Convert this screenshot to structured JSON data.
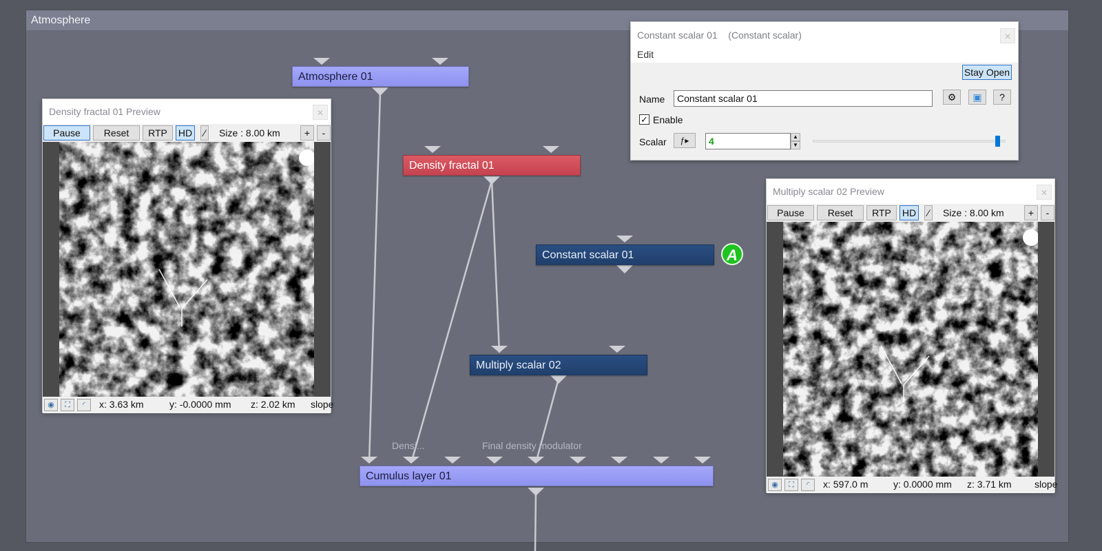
{
  "network": {
    "title": "Atmosphere"
  },
  "nodes": {
    "atmosphere": "Atmosphere 01",
    "density_fractal": "Density fractal 01",
    "constant_scalar": "Constant scalar 01",
    "multiply_scalar": "Multiply scalar 02",
    "cumulus_layer": "Cumulus layer 01"
  },
  "ports": {
    "densi": "Densi...",
    "final_density_modulator": "Final density modulator"
  },
  "badge": {
    "letter": "A",
    "color": "#1fc31f"
  },
  "preview_left": {
    "title": "Density fractal 01 Preview",
    "pause": "Pause",
    "reset": "Reset",
    "rtp": "RTP",
    "hd": "HD",
    "size": "Size :  8.00 km",
    "plus": "+",
    "minus": "-",
    "x": "x: 3.63 km",
    "y": "y: -0.0000 mm",
    "z": "z: 2.02 km",
    "slope": "slope"
  },
  "preview_right": {
    "title": "Multiply scalar 02 Preview",
    "pause": "Pause",
    "reset": "Reset",
    "rtp": "RTP",
    "hd": "HD",
    "size": "Size :  8.00 km",
    "plus": "+",
    "minus": "-",
    "x": "x: 597.0 m",
    "y": "y: 0.0000 mm",
    "z": "z: 3.71 km",
    "slope": "slope"
  },
  "edit_panel": {
    "title": "Constant scalar 01    (Constant scalar)",
    "menu_edit": "Edit",
    "stay_open": "Stay Open",
    "name_label": "Name",
    "name_value": "Constant scalar 01",
    "enable_label": "Enable",
    "enable_checked": "✓",
    "scalar_label": "Scalar",
    "scalar_value": "4",
    "help": "?",
    "slider_fraction": 0.97
  },
  "colors": {
    "node_light": "#8e92ee",
    "node_red": "#c54350",
    "node_blue": "#203f6c",
    "accent": "#0078d7"
  }
}
